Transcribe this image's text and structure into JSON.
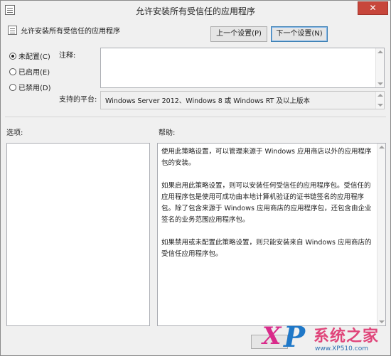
{
  "window": {
    "title": "允许安装所有受信任的应用程序",
    "close_label": "✕"
  },
  "header": {
    "policy_title": "允许安装所有受信任的应用程序",
    "prev_button": "上一个设置(P)",
    "next_button": "下一个设置(N)"
  },
  "radio_options": [
    {
      "label": "未配置(C)",
      "checked": true
    },
    {
      "label": "已启用(E)",
      "checked": false
    },
    {
      "label": "已禁用(D)",
      "checked": false
    }
  ],
  "comment": {
    "label": "注释:",
    "value": ""
  },
  "platform": {
    "label": "支持的平台:",
    "value": "Windows Server 2012、Windows 8 或 Windows RT 及以上版本"
  },
  "options": {
    "label": "选项:"
  },
  "help": {
    "label": "帮助:",
    "paragraphs": [
      "使用此策略设置，可以管理来源于 Windows 应用商店以外的应用程序包的安装。",
      "如果启用此策略设置，则可以安装任何受信任的应用程序包。受信任的应用程序包是使用可成功由本地计算机验证的证书链签名的应用程序包。除了包含来源于 Windows 应用商店的应用程序包，还包含由企业签名的业务范围应用程序包。",
      "如果禁用或未配置此策略设置，则只能安装来自 Windows 应用商店的受信任应用程序包。"
    ]
  },
  "watermark": {
    "logo_x": "X",
    "logo_p": "P",
    "brand": "系统之家",
    "url": "www.XP510.com"
  }
}
